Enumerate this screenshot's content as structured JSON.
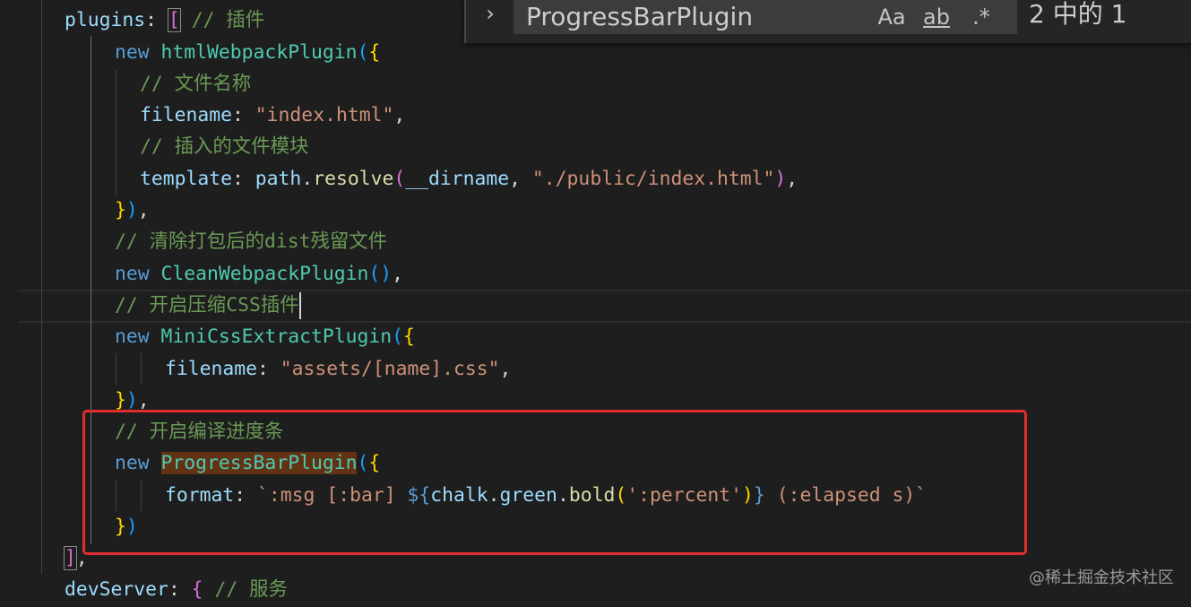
{
  "find_widget": {
    "toggle_icon": "chevron-right-icon",
    "query": "ProgressBarPlugin",
    "match_case_label": "Aa",
    "whole_word_label": "ab",
    "regex_label": ".*",
    "result_count": "2 中的 1"
  },
  "code": {
    "l1_prop": "plugins",
    "l1_colon": ": ",
    "l1_bracket": "[",
    "l1_comment": " // 插件",
    "l2_kw": "new",
    "l2_cls": "htmlWebpackPlugin",
    "l2_open": "(",
    "l2_brace": "{",
    "l3_comment": "// 文件名称",
    "l4_prop": "filename",
    "l4_colon": ": ",
    "l4_str": "\"index.html\"",
    "l4_comma": ",",
    "l5_comment": "// 插入的文件模块",
    "l6_prop": "template",
    "l6_colon": ": ",
    "l6_obj": "path",
    "l6_dot": ".",
    "l6_fn": "resolve",
    "l6_open": "(",
    "l6_arg1": "__dirname",
    "l6_sep": ", ",
    "l6_str": "\"./public/index.html\"",
    "l6_close": ")",
    "l6_comma": ",",
    "l7_brace": "}",
    "l7_close": ")",
    "l7_comma": ",",
    "l8_comment": "// 清除打包后的dist残留文件",
    "l9_kw": "new",
    "l9_cls": "CleanWebpackPlugin",
    "l9_paren": "()",
    "l9_comma": ",",
    "l10_comment": "// 开启压缩CSS插件",
    "l11_kw": "new",
    "l11_cls": "MiniCssExtractPlugin",
    "l11_open": "(",
    "l11_brace": "{",
    "l12_prop": "filename",
    "l12_colon": ": ",
    "l12_str": "\"assets/[name].css\"",
    "l12_comma": ",",
    "l13_brace": "}",
    "l13_close": ")",
    "l13_comma": ",",
    "l14_comment": "// 开启编译进度条",
    "l15_kw": "new",
    "l15_cls": "ProgressBarPlugin",
    "l15_open": "(",
    "l15_brace": "{",
    "l16_prop": "format",
    "l16_colon": ": ",
    "l16_str1": "`:msg [:bar] ",
    "l16_interp_open": "${",
    "l16_obj": "chalk",
    "l16_dot1": ".",
    "l16_prop2": "green",
    "l16_dot2": ".",
    "l16_fn": "bold",
    "l16_open": "(",
    "l16_arg": "':percent'",
    "l16_close": ")",
    "l16_interp_close": "}",
    "l16_str2": " (:elapsed s)`",
    "l17_brace": "}",
    "l17_close": ")",
    "l18_bracket": "]",
    "l18_comma": ",",
    "l19_prop": "devServer",
    "l19_colon": ": ",
    "l19_brace": "{",
    "l19_comment": " // 服务"
  },
  "watermark": "@稀土掘金技术社区",
  "colors": {
    "background": "#1e1e1e",
    "keyword": "#569cd6",
    "property": "#9cdcfe",
    "function": "#dcdcaa",
    "class": "#4ec9b0",
    "string": "#ce9178",
    "comment": "#6a9955",
    "highlight_box": "#e12d2d",
    "find_match": "#613214"
  }
}
